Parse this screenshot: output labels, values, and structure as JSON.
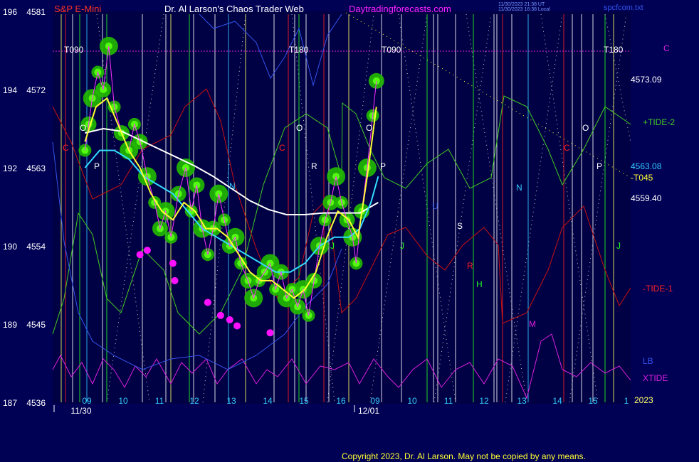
{
  "header": {
    "instrument": "S&P E-Mini",
    "title": "Dr. Al Larson's Chaos Trader Web",
    "site": "Daytradingforecasts.com",
    "timestamp_line1": "11/30/2023 21:38 UT",
    "timestamp_line2": "11/30/2023 16:38 Local",
    "file_name": "spcfcom.txt"
  },
  "footer": {
    "copyright": "Copyright 2023, Dr. Al Larson. May not be copied by any means.",
    "year": "2023"
  },
  "colors": {
    "background": "#000055",
    "plot_background": "#000044",
    "price": "#55ff11",
    "price_glow": "#22bb00",
    "fast_avg": "#ffff33",
    "slow_avg": "#33ddff",
    "long_avg": "#ffffff",
    "tide_plus": "#44cc22",
    "tide_minus": "#cc1111",
    "xtide": "#dd22dd",
    "lb": "#3355ee",
    "low_markers": "#ff11ff"
  },
  "chart_data": {
    "type": "line",
    "title": "S&P E-Mini",
    "y_left_ticks": [
      {
        "prefix": "196",
        "value": 4581
      },
      {
        "prefix": "194",
        "value": 4572
      },
      {
        "prefix": "192",
        "value": 4563
      },
      {
        "prefix": "190",
        "value": 4554
      },
      {
        "prefix": "189",
        "value": 4545
      },
      {
        "prefix": "187",
        "value": 4536
      }
    ],
    "ylim": [
      4536,
      4581
    ],
    "x_hours_day1": [
      "09",
      "10",
      "11",
      "12",
      "13",
      "14",
      "15",
      "16"
    ],
    "x_hours_day2": [
      "09",
      "10",
      "11",
      "12",
      "13",
      "14",
      "15",
      "1"
    ],
    "dates": [
      "11/30",
      "12/01"
    ],
    "right_price_labels": [
      {
        "label": "4573.09",
        "value": 4573.09
      },
      {
        "label": "4563.08",
        "value": 4563.08
      },
      {
        "label": "-T045",
        "value": 4561.6
      },
      {
        "label": "4559.40",
        "value": 4559.4
      }
    ],
    "right_series_labels": [
      "C",
      "+TIDE-2",
      "-TIDE-1",
      "LB",
      "XTIDE"
    ],
    "timing_labels": [
      "T090",
      "T180",
      "T090",
      "T180"
    ],
    "cycle_letters": [
      "O",
      "P",
      "C",
      "N",
      "C",
      "O",
      "R",
      "J",
      "O",
      "P",
      "U",
      "S",
      "R",
      "H",
      "J",
      "N",
      "M",
      "C",
      "O",
      "P",
      "J"
    ],
    "price_series": [
      {
        "h": 9.0,
        "v": 4565
      },
      {
        "h": 9.1,
        "v": 4568
      },
      {
        "h": 9.2,
        "v": 4571
      },
      {
        "h": 9.35,
        "v": 4574
      },
      {
        "h": 9.5,
        "v": 4572
      },
      {
        "h": 9.65,
        "v": 4577
      },
      {
        "h": 9.8,
        "v": 4570
      },
      {
        "h": 10.0,
        "v": 4567
      },
      {
        "h": 10.2,
        "v": 4565
      },
      {
        "h": 10.35,
        "v": 4568
      },
      {
        "h": 10.5,
        "v": 4566
      },
      {
        "h": 10.7,
        "v": 4562
      },
      {
        "h": 10.9,
        "v": 4559
      },
      {
        "h": 11.05,
        "v": 4556
      },
      {
        "h": 11.2,
        "v": 4558
      },
      {
        "h": 11.35,
        "v": 4555
      },
      {
        "h": 11.55,
        "v": 4560
      },
      {
        "h": 11.75,
        "v": 4563
      },
      {
        "h": 11.9,
        "v": 4558
      },
      {
        "h": 12.05,
        "v": 4561
      },
      {
        "h": 12.2,
        "v": 4556
      },
      {
        "h": 12.35,
        "v": 4553
      },
      {
        "h": 12.5,
        "v": 4556
      },
      {
        "h": 12.65,
        "v": 4560
      },
      {
        "h": 12.8,
        "v": 4557
      },
      {
        "h": 12.95,
        "v": 4554
      },
      {
        "h": 13.1,
        "v": 4555
      },
      {
        "h": 13.25,
        "v": 4552
      },
      {
        "h": 13.45,
        "v": 4550
      },
      {
        "h": 13.6,
        "v": 4548
      },
      {
        "h": 13.75,
        "v": 4550
      },
      {
        "h": 13.9,
        "v": 4551
      },
      {
        "h": 14.05,
        "v": 4552
      },
      {
        "h": 14.2,
        "v": 4549
      },
      {
        "h": 14.35,
        "v": 4551
      },
      {
        "h": 14.5,
        "v": 4548
      },
      {
        "h": 14.65,
        "v": 4549
      },
      {
        "h": 14.8,
        "v": 4547
      },
      {
        "h": 14.95,
        "v": 4549
      },
      {
        "h": 15.1,
        "v": 4546
      },
      {
        "h": 15.25,
        "v": 4550
      },
      {
        "h": 15.4,
        "v": 4554
      },
      {
        "h": 15.55,
        "v": 4557
      },
      {
        "h": 15.7,
        "v": 4559
      },
      {
        "h": 15.85,
        "v": 4562
      },
      {
        "h": 16.0,
        "v": 4559
      },
      {
        "h": 16.15,
        "v": 4557
      },
      {
        "h": 16.3,
        "v": 4555
      },
      {
        "h": 16.4,
        "v": 4552
      },
      {
        "h": 16.55,
        "v": 4558
      },
      {
        "h": 16.7,
        "v": 4563
      },
      {
        "h": 16.85,
        "v": 4569
      },
      {
        "h": 16.95,
        "v": 4573
      }
    ],
    "fast_avg_series": [
      {
        "h": 9.0,
        "v": 4566
      },
      {
        "h": 9.3,
        "v": 4570
      },
      {
        "h": 9.6,
        "v": 4571
      },
      {
        "h": 9.9,
        "v": 4568
      },
      {
        "h": 10.2,
        "v": 4565
      },
      {
        "h": 10.5,
        "v": 4563
      },
      {
        "h": 10.8,
        "v": 4560
      },
      {
        "h": 11.1,
        "v": 4558
      },
      {
        "h": 11.4,
        "v": 4557
      },
      {
        "h": 11.7,
        "v": 4559
      },
      {
        "h": 12.0,
        "v": 4558
      },
      {
        "h": 12.3,
        "v": 4556
      },
      {
        "h": 12.6,
        "v": 4556
      },
      {
        "h": 12.9,
        "v": 4555
      },
      {
        "h": 13.2,
        "v": 4553
      },
      {
        "h": 13.5,
        "v": 4551
      },
      {
        "h": 13.8,
        "v": 4550
      },
      {
        "h": 14.1,
        "v": 4550
      },
      {
        "h": 14.4,
        "v": 4549
      },
      {
        "h": 14.7,
        "v": 4548
      },
      {
        "h": 15.0,
        "v": 4549
      },
      {
        "h": 15.3,
        "v": 4551
      },
      {
        "h": 15.6,
        "v": 4555
      },
      {
        "h": 15.9,
        "v": 4558
      },
      {
        "h": 16.2,
        "v": 4557
      },
      {
        "h": 16.45,
        "v": 4555
      },
      {
        "h": 16.7,
        "v": 4562
      },
      {
        "h": 16.95,
        "v": 4570
      }
    ],
    "slow_avg_series": [
      {
        "h": 9.0,
        "v": 4563
      },
      {
        "h": 9.4,
        "v": 4565
      },
      {
        "h": 9.8,
        "v": 4565
      },
      {
        "h": 10.2,
        "v": 4564
      },
      {
        "h": 10.6,
        "v": 4562
      },
      {
        "h": 11.0,
        "v": 4561
      },
      {
        "h": 11.4,
        "v": 4560
      },
      {
        "h": 11.8,
        "v": 4558
      },
      {
        "h": 12.2,
        "v": 4556
      },
      {
        "h": 12.6,
        "v": 4555
      },
      {
        "h": 13.0,
        "v": 4554
      },
      {
        "h": 13.4,
        "v": 4553
      },
      {
        "h": 13.8,
        "v": 4552
      },
      {
        "h": 14.2,
        "v": 4551
      },
      {
        "h": 14.6,
        "v": 4551
      },
      {
        "h": 15.0,
        "v": 4552
      },
      {
        "h": 15.4,
        "v": 4554
      },
      {
        "h": 15.8,
        "v": 4555
      },
      {
        "h": 16.2,
        "v": 4555
      },
      {
        "h": 16.5,
        "v": 4556
      },
      {
        "h": 16.8,
        "v": 4559
      },
      {
        "h": 17.0,
        "v": 4562
      }
    ],
    "long_avg_series": [
      {
        "h": 9.0,
        "v": 4567
      },
      {
        "h": 9.5,
        "v": 4567.5
      },
      {
        "h": 10.0,
        "v": 4567.2
      },
      {
        "h": 10.5,
        "v": 4566.2
      },
      {
        "h": 11.0,
        "v": 4565.2
      },
      {
        "h": 11.5,
        "v": 4564.2
      },
      {
        "h": 12.0,
        "v": 4563.2
      },
      {
        "h": 12.5,
        "v": 4562
      },
      {
        "h": 13.0,
        "v": 4560.6
      },
      {
        "h": 13.5,
        "v": 4559.2
      },
      {
        "h": 14.0,
        "v": 4558.2
      },
      {
        "h": 14.5,
        "v": 4557.6
      },
      {
        "h": 15.0,
        "v": 4557.6
      },
      {
        "h": 15.5,
        "v": 4557.8
      },
      {
        "h": 16.0,
        "v": 4557.8
      },
      {
        "h": 16.5,
        "v": 4557.8
      },
      {
        "h": 17.0,
        "v": 4559
      }
    ],
    "lows_marked": [
      {
        "h": 10.5,
        "v": 4553
      },
      {
        "h": 10.7,
        "v": 4553.5
      },
      {
        "h": 11.4,
        "v": 4552
      },
      {
        "h": 11.45,
        "v": 4550
      },
      {
        "h": 12.35,
        "v": 4547.5
      },
      {
        "h": 12.7,
        "v": 4546
      },
      {
        "h": 12.95,
        "v": 4545.5
      },
      {
        "h": 13.15,
        "v": 4544.8
      },
      {
        "h": 14.05,
        "v": 4544
      }
    ]
  }
}
